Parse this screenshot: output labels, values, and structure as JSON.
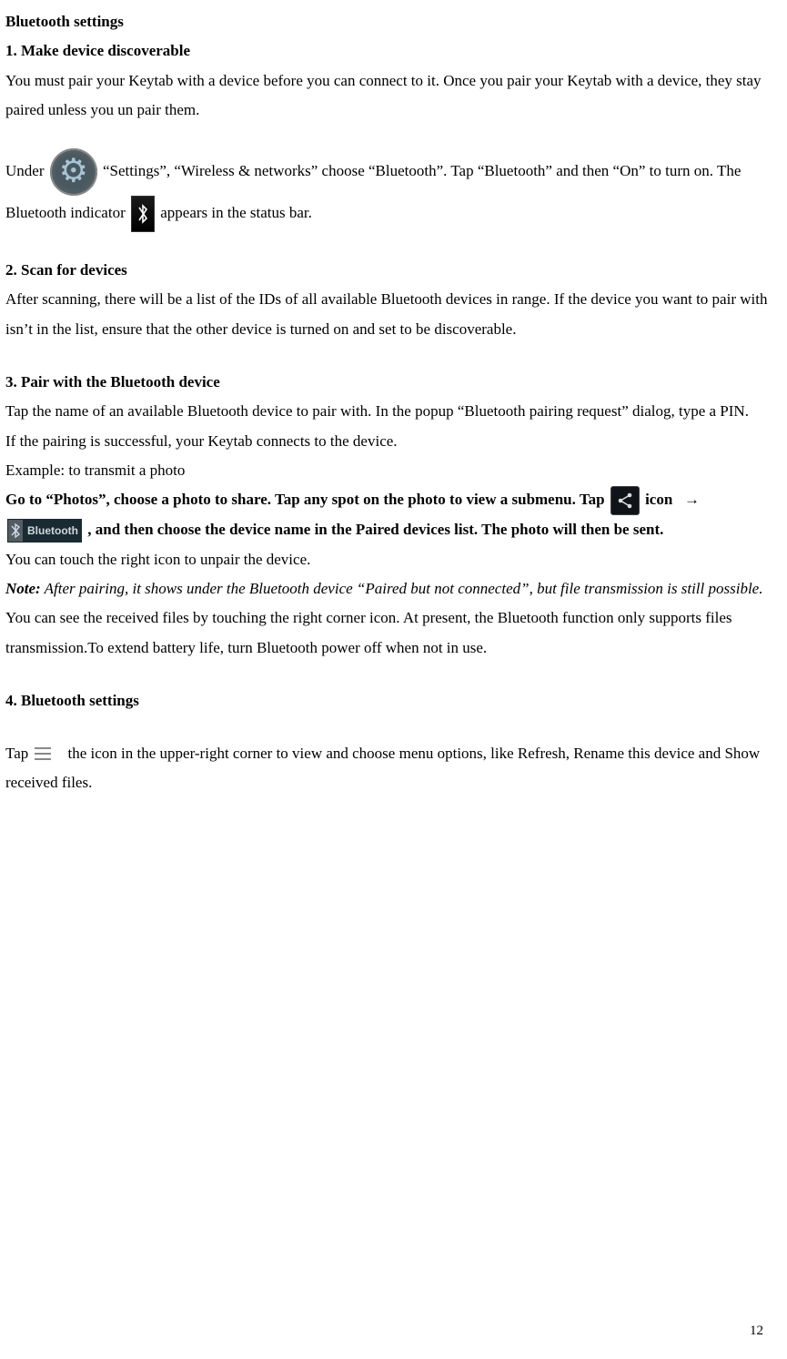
{
  "title": "Bluetooth settings",
  "s1": {
    "heading": "1. Make device discoverable",
    "p1": "You must pair your Keytab with a device before you can connect to it. Once you pair your Keytab with a device, they stay paired unless you un pair them.",
    "p2a": "Under ",
    "p2b": " “Settings”, “Wireless & networks” choose “Bluetooth”. Tap “Bluetooth” and then “On” to turn on. The Bluetooth indicator ",
    "p2c": " appears in the status bar."
  },
  "s2": {
    "heading": "2. Scan for devices",
    "p1": "After scanning, there will be a list of the IDs of all available Bluetooth devices in range. If the device you want to pair with isn’t in the list, ensure that the other device is turned on and set to be discoverable."
  },
  "s3": {
    "heading": "3. Pair with the Bluetooth device",
    "p1": "Tap the name of an available Bluetooth device to pair with. In the popup “Bluetooth pairing request” dialog, type a PIN.",
    "p2": "If the pairing is successful, your Keytab connects to the device.",
    "p3": "Example: to transmit a photo",
    "bold_a": "Go to “Photos”, choose a photo to share. Tap any spot on the photo to view a submenu. Tap ",
    "bold_b": " icon   →  ",
    "bold_c": ", and then choose the device name in the Paired devices list. The photo will then be sent.",
    "bt_button_label": "Bluetooth",
    "p4": "You can touch the right icon to unpair the device.",
    "note_label": "Note:",
    "note_text": " After pairing, it shows under the Bluetooth device “Paired but not connected”, but file transmission is still possible.",
    "p5": "You can see the received files by touching the right corner icon. At present, the Bluetooth function only supports files transmission.To extend battery life, turn Bluetooth power off when not in use."
  },
  "s4": {
    "heading": "4. Bluetooth settings",
    "p1a": "Tap ",
    "p1b": " the icon in the upper-right corner to view and choose menu options, like Refresh, Rename this device and Show received files."
  },
  "page_number": "12"
}
